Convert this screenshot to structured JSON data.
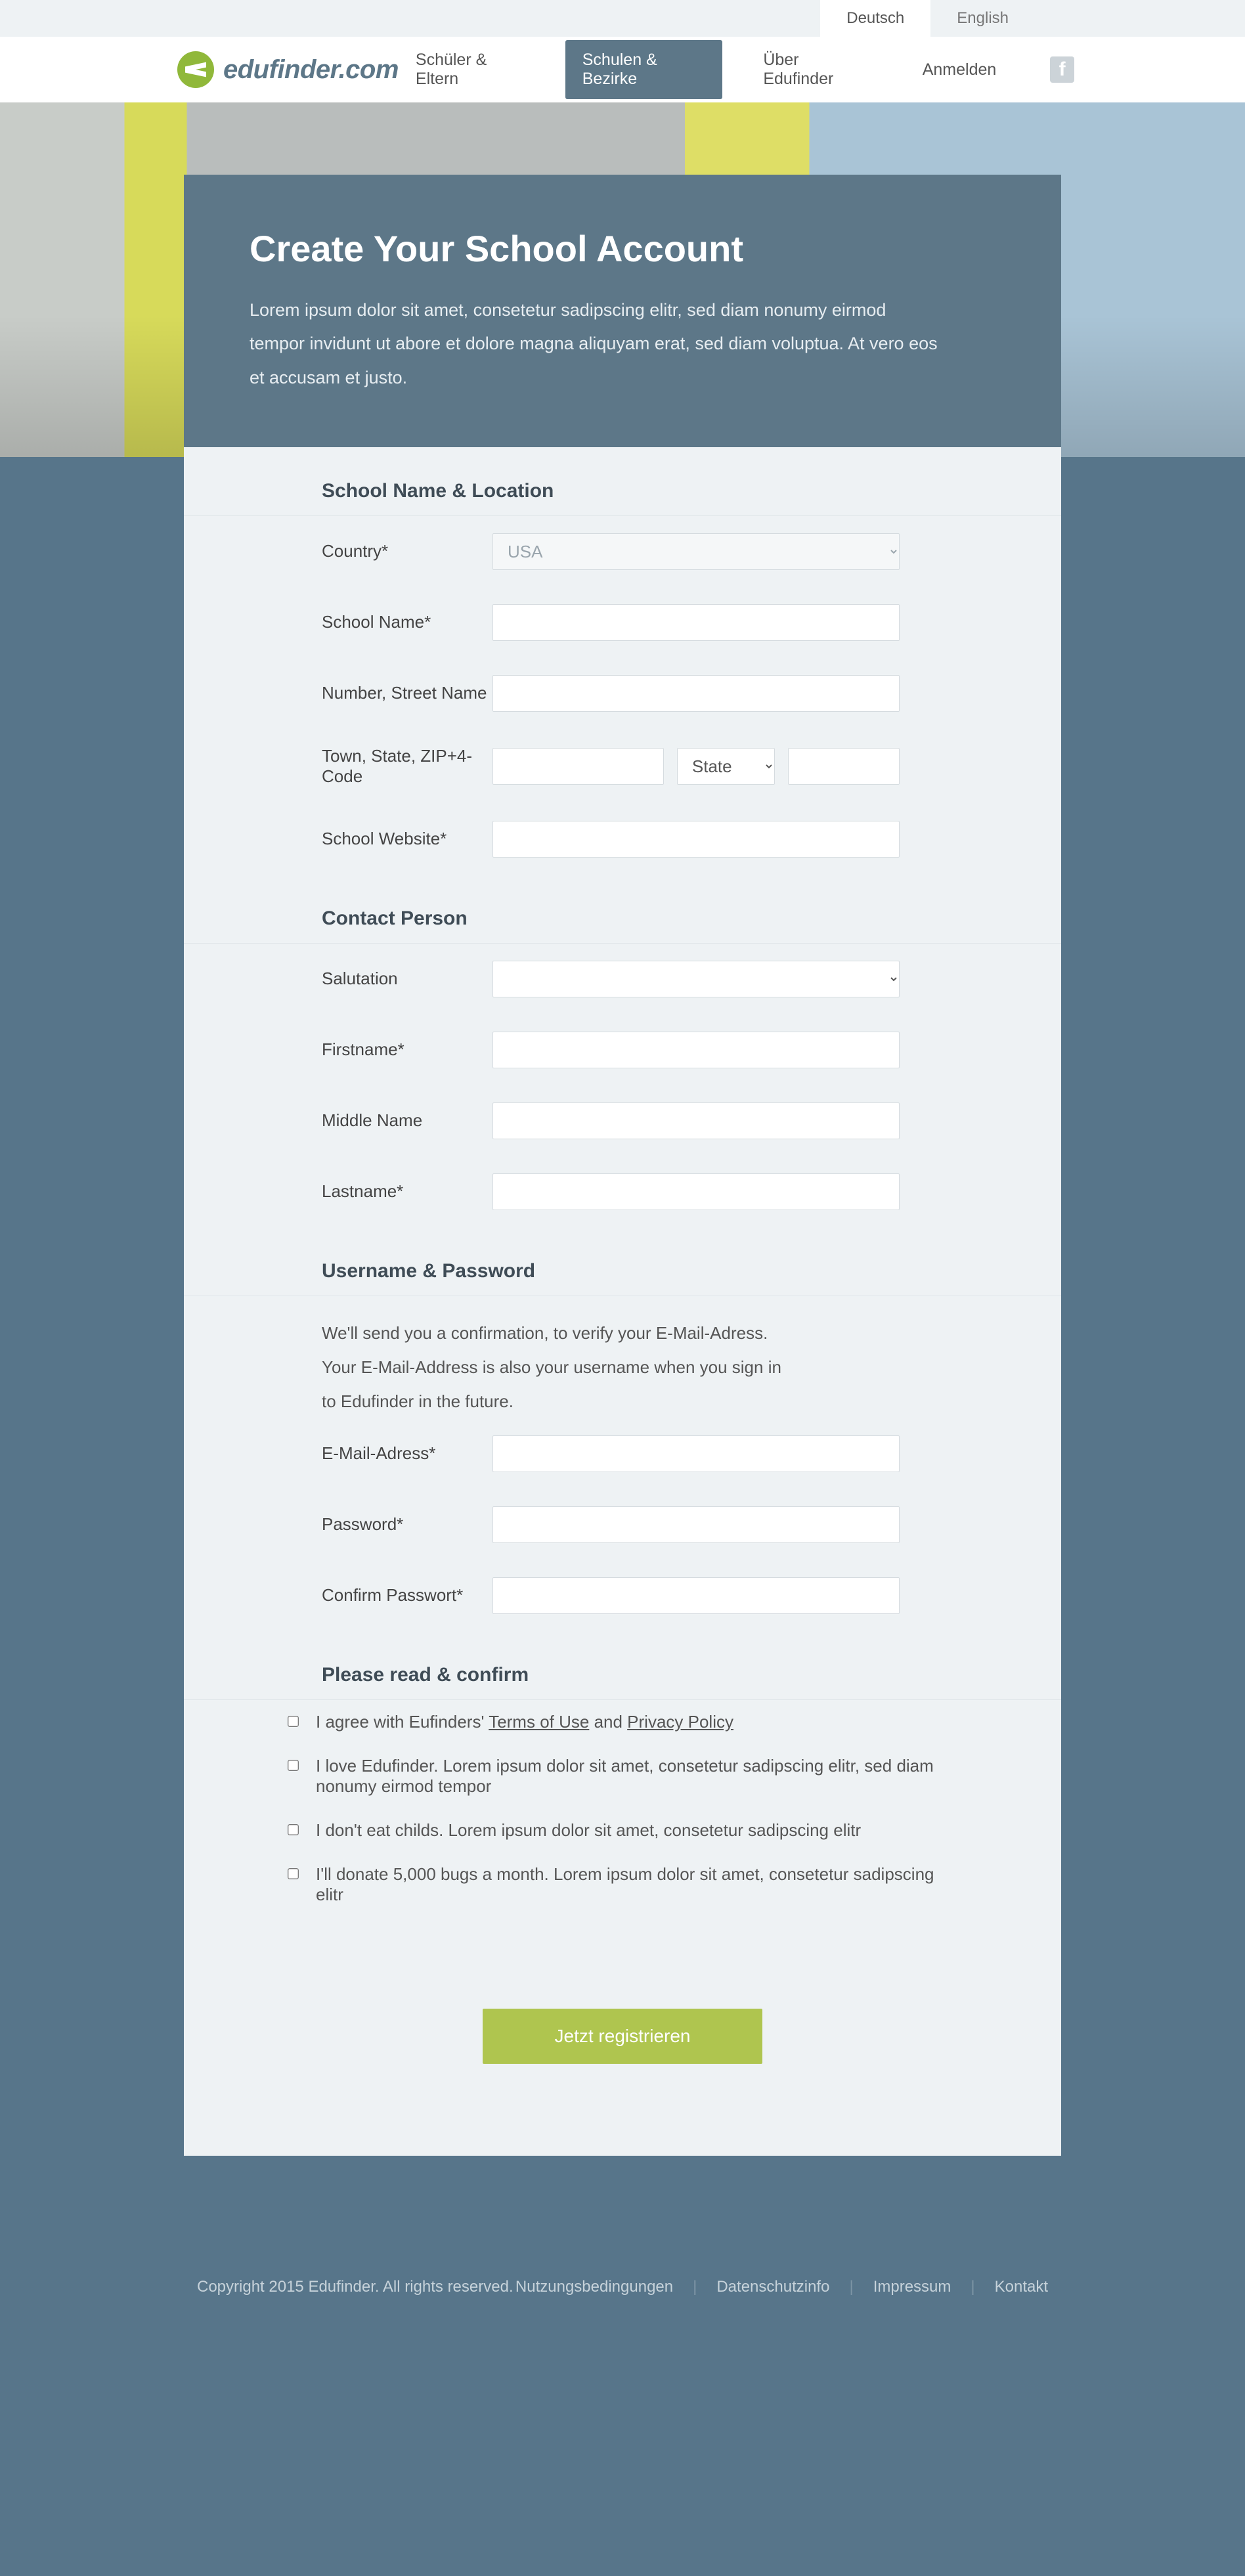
{
  "langbar": {
    "de": "Deutsch",
    "en": "English"
  },
  "brand": {
    "name": "edufinder.com"
  },
  "nav": {
    "students": "Schüler & Eltern",
    "schools": "Schulen & Bezirke",
    "about": "Über Edufinder",
    "login": "Anmelden"
  },
  "hero": {
    "title": "Create Your School Account",
    "intro": "Lorem ipsum dolor sit amet, consetetur sadipscing elitr, sed diam nonumy eirmod tempor invidunt ut abore et dolore magna aliquyam erat, sed diam voluptua. At vero eos et accusam et justo."
  },
  "section": {
    "s1": "School Name & Location",
    "s2": "Contact Person",
    "s3": "Username & Password",
    "s4": "Please read & confirm",
    "s3_note": "We'll send you a confirmation, to verify your E-Mail-Adress. Your E-Mail-Address is also your username when you sign in to Edufinder in the future."
  },
  "labels": {
    "country": "Country*",
    "school": "School Name*",
    "street": "Number, Street Name",
    "tsz": "Town, State, ZIP+4-Code",
    "website": "School Website*",
    "salut": "Salutation",
    "first": "Firstname*",
    "middle": "Middle Name",
    "last": "Lastname*",
    "email": "E-Mail-Adress*",
    "pass": "Password*",
    "pass2": "Confirm Passwort*",
    "state_ph": "State"
  },
  "options": {
    "country_default": "USA"
  },
  "checks": {
    "c1_pre": "I agree with Eufinders' ",
    "c1_tou": "Terms of Use",
    "c1_mid": " and ",
    "c1_pp": "Privacy Policy",
    "c2": "I love Edufinder. Lorem ipsum dolor sit amet, consetetur sadipscing elitr, sed diam nonumy eirmod tempor",
    "c3": "I don't eat childs. Lorem ipsum dolor sit amet, consetetur sadipscing elitr",
    "c4": "I'll donate 5,000 bugs a month. Lorem ipsum dolor sit amet, consetetur sadipscing elitr"
  },
  "submit": "Jetzt registrieren",
  "footer": {
    "copyright": "Copyright 2015 Edufinder. All rights reserved.",
    "l1": "Nutzungsbedingungen",
    "l2": "Datenschutzinfo",
    "l3": "Impressum",
    "l4": "Kontakt"
  }
}
